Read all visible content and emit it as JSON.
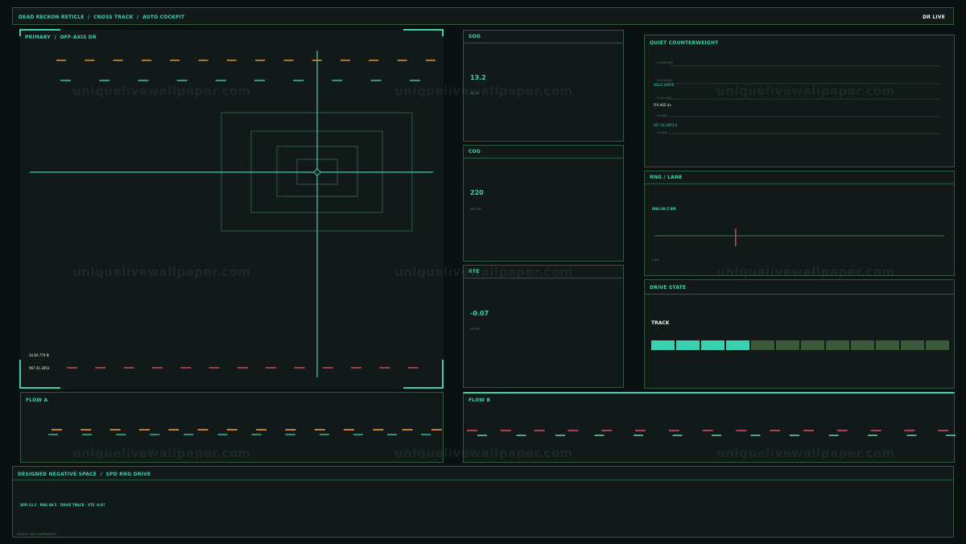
{
  "header": {
    "title": "DEAD RECKON RETICLE",
    "crumb_1": "CROSS TRACK",
    "crumb_2": "AUTO COCKPIT",
    "status": "DR LIVE"
  },
  "primary": {
    "title": "PRIMARY",
    "subtitle": "OFF-AXIS DR",
    "readout_1": "34 84.779 N",
    "readout_2": "067 41.2853"
  },
  "sog": {
    "label": "SOG",
    "value": "13.2",
    "unit": "KN DR"
  },
  "cog": {
    "label": "COG",
    "value": "220",
    "unit": "DEG DR"
  },
  "xte": {
    "label": "XTE",
    "value": "-0.07",
    "unit": "NM DR"
  },
  "counterweight": {
    "title": "QUIET COUNTERWEIGHT",
    "row_1": "0.0098 M/S",
    "row_2": "0.0142 M/S",
    "label_1": "HOLD SPACE",
    "row_3": "0.021 M/S",
    "label_2": "FIX AGE 4s",
    "row_4": "0.0 M/S",
    "label_3": "067 41.2853 E",
    "row_5": "0.0 M/S"
  },
  "rng": {
    "title": "RNG / LANE",
    "value": "RNG 89.5 NM",
    "foot": "LANE",
    "marker_fraction": 0.28
  },
  "drive": {
    "title": "DRIVE STATE",
    "state": "TRACK",
    "segments_total": 12,
    "segments_active": 4
  },
  "flow_a": {
    "title": "FLOW A"
  },
  "flow_b": {
    "title": "FLOW B"
  },
  "footer": {
    "title": "DESIGNED NEGATIVE SPACE",
    "subtitle": "SPD RNG DRIVE",
    "spd": "SPD 13.2",
    "rng": "RNG 89.5",
    "drive": "DRIVE TRACK",
    "xte": "XTE -0.07",
    "foot": "MANUAL NAV COMPONENTS"
  },
  "watermark": "uniquelivewallpaper.com",
  "colors": {
    "accent": "#39d1b0",
    "amber": "#d58a2e",
    "red": "#c0474f",
    "border": "#2e5a3f",
    "bar_off": "#3a5a3a"
  }
}
